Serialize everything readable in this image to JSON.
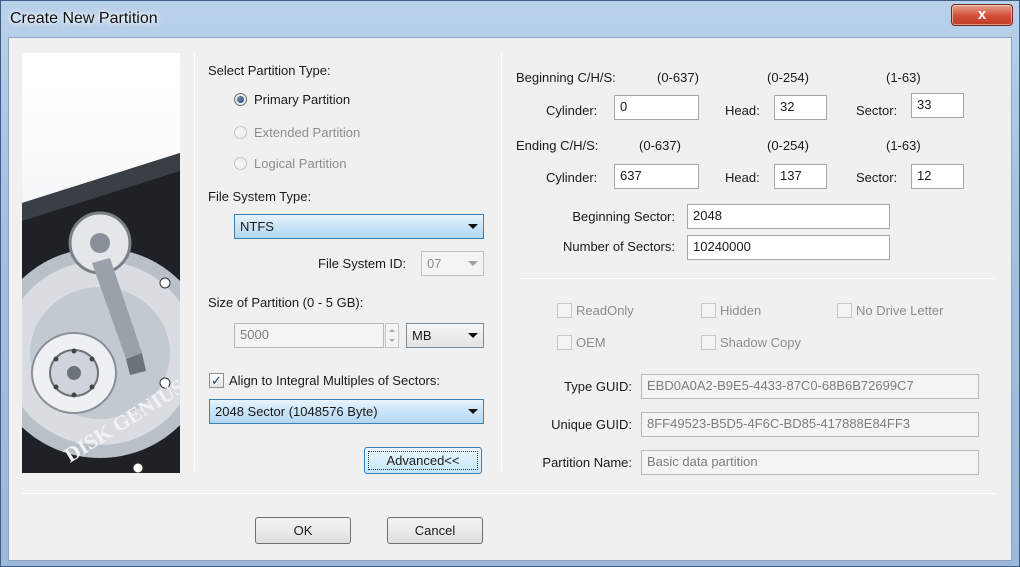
{
  "window": {
    "title": "Create New Partition",
    "close_label": "x"
  },
  "left": {
    "logo_text": "DISK GENIUS",
    "partition_type_label": "Select Partition Type:",
    "partition_types": [
      {
        "label": "Primary Partition",
        "checked": true,
        "enabled": true
      },
      {
        "label": "Extended Partition",
        "checked": false,
        "enabled": false
      },
      {
        "label": "Logical Partition",
        "checked": false,
        "enabled": false
      }
    ],
    "fs_type_label": "File System Type:",
    "fs_type_value": "NTFS",
    "fs_id_label": "File System ID:",
    "fs_id_value": "07",
    "size_label": "Size of Partition (0 - 5 GB):",
    "size_value": "5000",
    "size_unit": "MB",
    "align_label": "Align to Integral Multiples of Sectors:",
    "align_checked": true,
    "align_value": "2048 Sector (1048576 Byte)",
    "advanced_label": "Advanced<<"
  },
  "right": {
    "beginning_chs_label": "Beginning C/H/S:",
    "ending_chs_label": "Ending C/H/S:",
    "cyl_range": "(0-637)",
    "head_range": "(0-254)",
    "sector_range": "(1-63)",
    "cylinder_label": "Cylinder:",
    "head_label": "Head:",
    "sector_label": "Sector:",
    "begin_cylinder": "0",
    "begin_head": "32",
    "begin_sector": "33",
    "end_cylinder": "637",
    "end_head": "137",
    "end_sector": "12",
    "beginning_sector_label": "Beginning Sector:",
    "beginning_sector_value": "2048",
    "num_sectors_label": "Number of Sectors:",
    "num_sectors_value": "10240000",
    "attributes": {
      "readonly": "ReadOnly",
      "hidden": "Hidden",
      "no_drive_letter": "No Drive Letter",
      "oem": "OEM",
      "shadow_copy": "Shadow Copy"
    },
    "type_guid_label": "Type GUID:",
    "type_guid_value": "EBD0A0A2-B9E5-4433-87C0-68B6B72699C7",
    "unique_guid_label": "Unique GUID:",
    "unique_guid_value": "8FF49523-B5D5-4F6C-BD85-417888E84FF3",
    "partition_name_label": "Partition Name:",
    "partition_name_value": "Basic data partition"
  },
  "footer": {
    "ok_label": "OK",
    "cancel_label": "Cancel"
  }
}
